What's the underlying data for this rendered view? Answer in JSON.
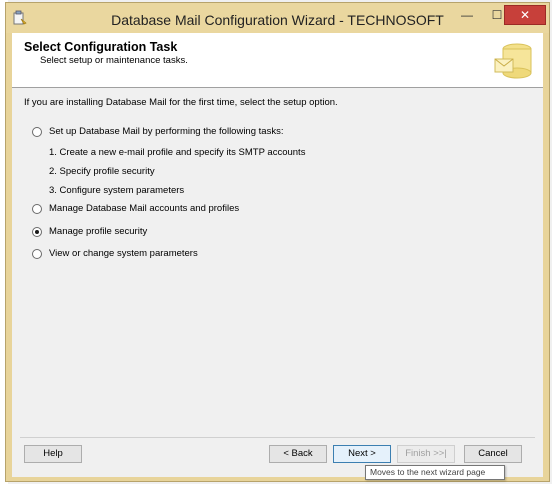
{
  "window": {
    "title": "Database Mail Configuration Wizard - TECHNOSOFT",
    "minimize_glyph": "—",
    "maximize_glyph": "☐",
    "close_glyph": "✕"
  },
  "header": {
    "title": "Select Configuration Task",
    "subtitle": "Select setup or maintenance tasks."
  },
  "intro": "If you are installing Database Mail for the first time, select the setup option.",
  "options": [
    {
      "label": "Set up Database Mail by performing the following tasks:",
      "checked": false
    },
    {
      "label": "Manage Database Mail accounts and profiles",
      "checked": false
    },
    {
      "label": "Manage profile security",
      "checked": true
    },
    {
      "label": "View or change system parameters",
      "checked": false
    }
  ],
  "setup_steps": [
    "1. Create a new e-mail profile and specify its SMTP accounts",
    "2. Specify profile security",
    "3. Configure system parameters"
  ],
  "buttons": {
    "help": "Help",
    "back": "< Back",
    "next": "Next >",
    "finish": "Finish >>|",
    "cancel": "Cancel"
  },
  "tooltip": "Moves to the next wizard page",
  "colors": {
    "titlebar": "#ead79f",
    "close_button": "#c7403a",
    "accent": "#3c7fb1"
  }
}
